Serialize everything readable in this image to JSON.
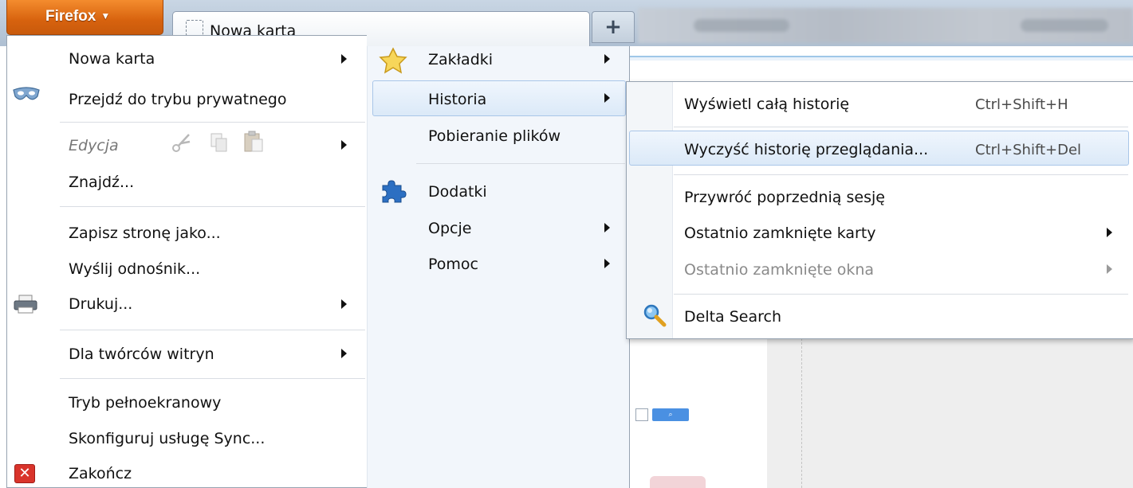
{
  "app_button": {
    "label": "Firefox",
    "caret": "▼"
  },
  "tab": {
    "title": "Nowa karta"
  },
  "new_tab": {
    "label": "+"
  },
  "main_menu": {
    "items": [
      {
        "label": "Nowa karta",
        "icon": "",
        "has_submenu": true
      },
      {
        "label": "Przejdź do trybu prywatnego",
        "icon": "private-mask-icon",
        "has_submenu": false
      },
      {
        "label": "Edycja",
        "icon": "",
        "has_submenu": true,
        "disabled": true
      },
      {
        "label": "Znajdź...",
        "icon": "",
        "has_submenu": false
      },
      {
        "label": "Zapisz stronę jako...",
        "icon": "",
        "has_submenu": false
      },
      {
        "label": "Wyślij odnośnik...",
        "icon": "",
        "has_submenu": false
      },
      {
        "label": "Drukuj...",
        "icon": "printer-icon",
        "has_submenu": true
      },
      {
        "label": "Dla twórców witryn",
        "icon": "",
        "has_submenu": true
      },
      {
        "label": "Tryb pełnoekranowy",
        "icon": "",
        "has_submenu": false
      },
      {
        "label": "Skonfiguruj usługę Sync...",
        "icon": "",
        "has_submenu": false
      },
      {
        "label": "Zakończ",
        "icon": "quit-icon",
        "has_submenu": false
      }
    ]
  },
  "right_column": {
    "items": [
      {
        "label": "Zakładki",
        "icon": "star-icon",
        "has_submenu": true
      },
      {
        "label": "Historia",
        "icon": "",
        "has_submenu": true,
        "highlighted": true
      },
      {
        "label": "Pobieranie plików",
        "icon": "",
        "has_submenu": false
      },
      {
        "label": "Dodatki",
        "icon": "puzzle-icon",
        "has_submenu": false
      },
      {
        "label": "Opcje",
        "icon": "",
        "has_submenu": true
      },
      {
        "label": "Pomoc",
        "icon": "",
        "has_submenu": true
      }
    ]
  },
  "history_submenu": {
    "items": [
      {
        "label": "Wyświetl całą historię",
        "shortcut": "Ctrl+Shift+H"
      },
      {
        "label": "Wyczyść historię przeglądania...",
        "shortcut": "Ctrl+Shift+Del",
        "highlighted": true
      },
      {
        "label": "Przywróć poprzednią sesję",
        "shortcut": ""
      },
      {
        "label": "Ostatnio zamknięte karty",
        "shortcut": "",
        "has_submenu": true
      },
      {
        "label": "Ostatnio zamknięte okna",
        "shortcut": "",
        "has_submenu": true,
        "disabled": true
      },
      {
        "label": "Delta Search",
        "shortcut": "",
        "icon": "magnifier-icon"
      }
    ]
  },
  "colors": {
    "app_button": "#e2701a",
    "highlight": "#dbe9f8",
    "highlight_border": "#a9c6e8",
    "disabled_text": "#8a8a8a"
  }
}
